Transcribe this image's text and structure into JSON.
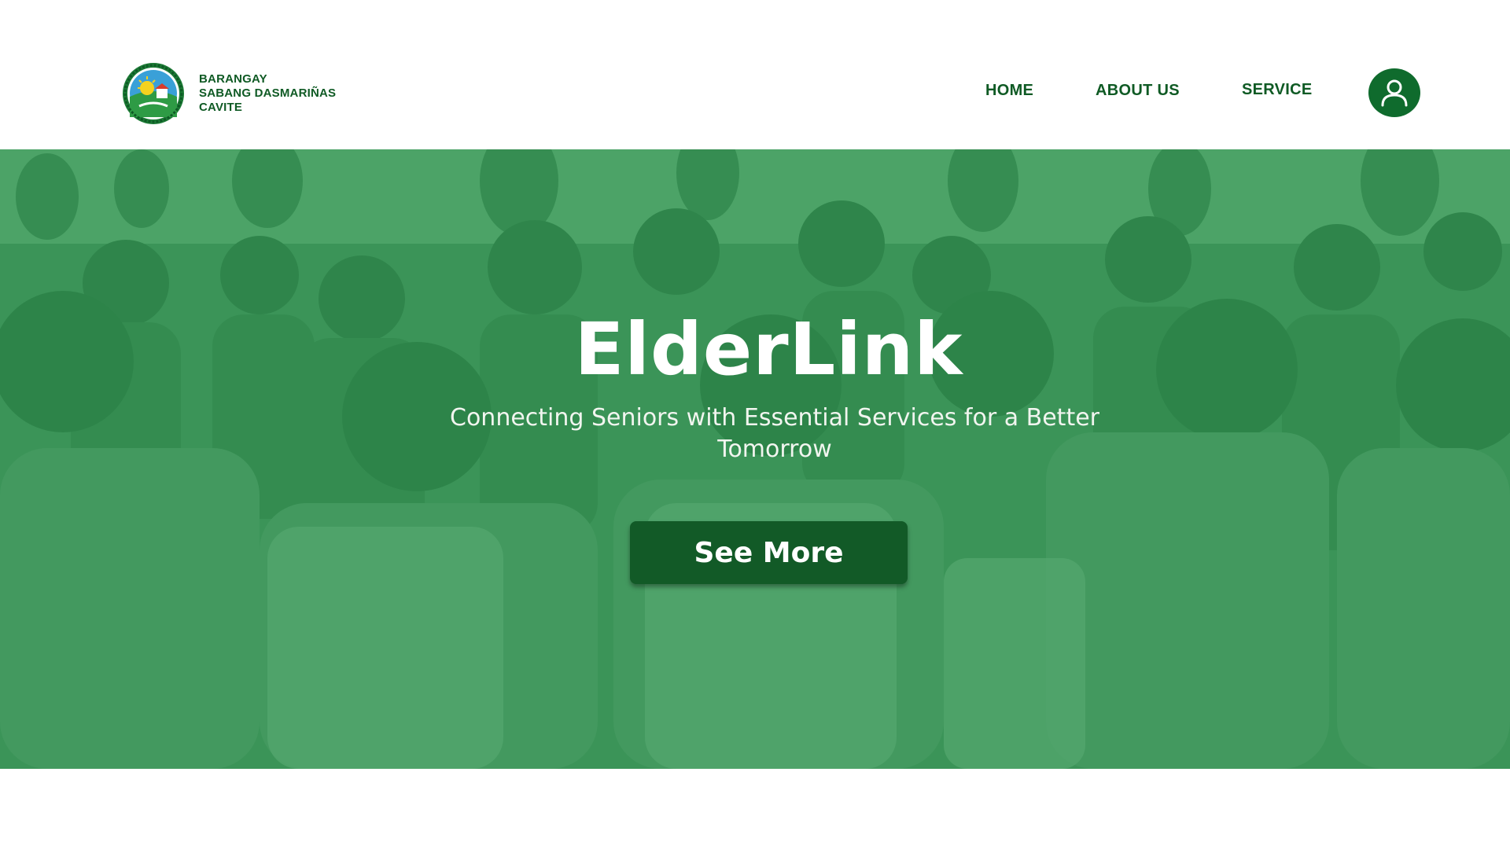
{
  "brand": {
    "line1": "BARANGAY",
    "line2": "SABANG DASMARIÑAS",
    "line3": "CAVITE",
    "seal_icon": "barangay-seal-logo"
  },
  "nav": {
    "home": "HOME",
    "about": "ABOUT US",
    "service": "SERVICE",
    "profile_icon": "user-icon"
  },
  "hero": {
    "title": "ElderLink",
    "subtitle": "Connecting Seniors with Essential Services for a Better Tomorrow",
    "button_label": "See More",
    "background_image": "crowd-of-seniors-photo"
  },
  "colors": {
    "brand_green": "#0f5a24",
    "profile_green": "#0f6b2d",
    "hero_overlay": "#228c48",
    "button_green": "#125a27",
    "white": "#ffffff"
  }
}
